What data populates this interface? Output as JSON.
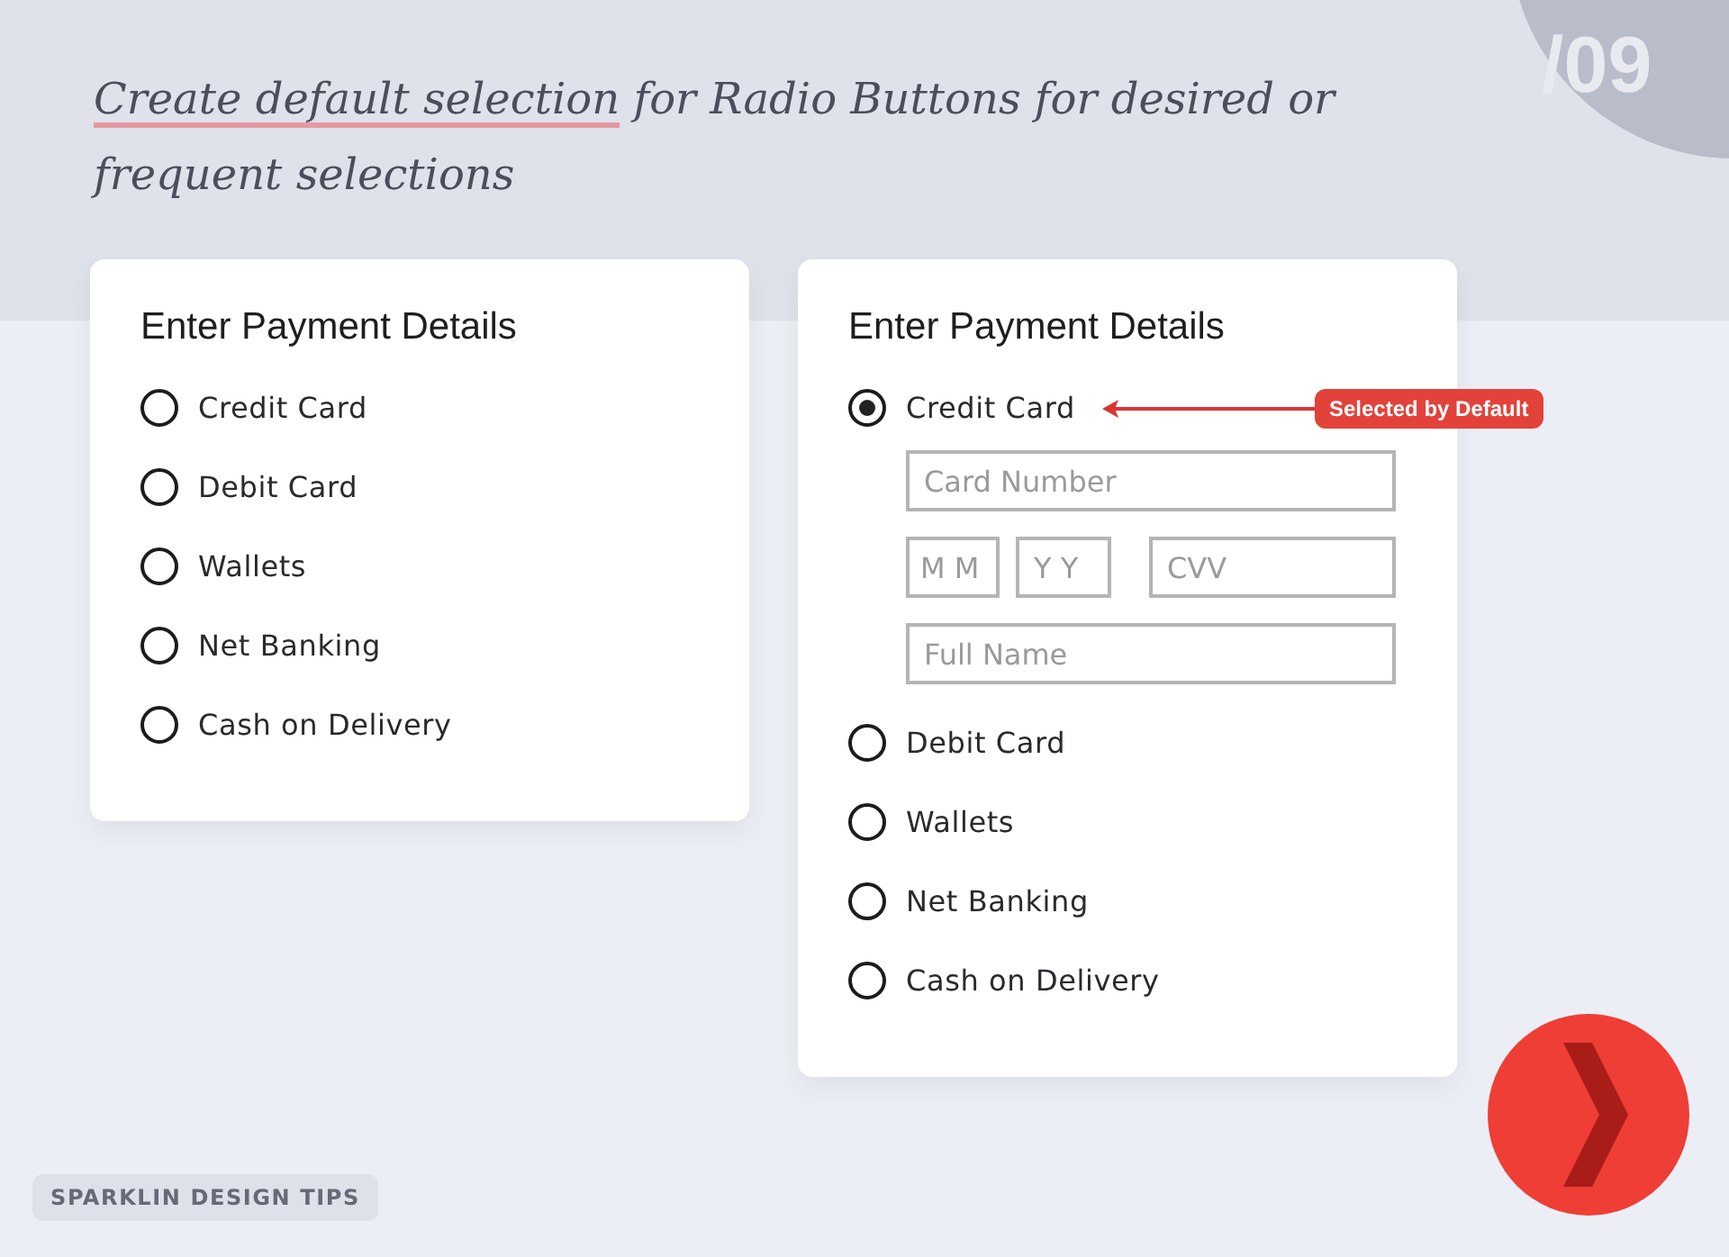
{
  "heading": {
    "highlight": "Create default selection",
    "rest": "for Radio Buttons for desired or frequent selections"
  },
  "page_number": "/09",
  "cards": [
    {
      "title": "Enter Payment Details",
      "options": [
        {
          "label": "Credit Card",
          "selected": false
        },
        {
          "label": "Debit Card",
          "selected": false
        },
        {
          "label": "Wallets",
          "selected": false
        },
        {
          "label": "Net Banking",
          "selected": false
        },
        {
          "label": "Cash on Delivery",
          "selected": false
        }
      ]
    },
    {
      "title": "Enter Payment Details",
      "options": [
        {
          "label": "Credit Card",
          "selected": true,
          "callout": "Selected by Default",
          "field_rows": [
            [
              {
                "placeholder": "Card Number"
              }
            ],
            [
              {
                "placeholder": "M M"
              },
              {
                "placeholder": "Y Y"
              },
              {
                "placeholder": "CVV"
              }
            ],
            [
              {
                "placeholder": "Full Name"
              }
            ]
          ]
        },
        {
          "label": "Debit Card",
          "selected": false
        },
        {
          "label": "Wallets",
          "selected": false
        },
        {
          "label": "Net Banking",
          "selected": false
        },
        {
          "label": "Cash on Delivery",
          "selected": false
        }
      ]
    }
  ],
  "footer_badge": "SPARKLIN DESIGN TIPS"
}
